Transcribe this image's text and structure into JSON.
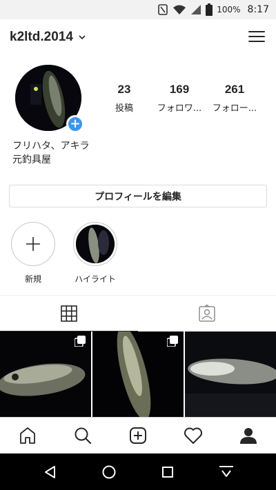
{
  "status_bar": {
    "battery": "100%",
    "time": "8:17"
  },
  "header": {
    "username": "k2ltd.2014"
  },
  "profile": {
    "stats": [
      {
        "value": "23",
        "label": "投稿"
      },
      {
        "value": "169",
        "label": "フォロワ..."
      },
      {
        "value": "261",
        "label": "フォロー..."
      }
    ],
    "bio_lines": [
      "フリハタ、アキラ",
      "元釣具屋"
    ],
    "edit_button": "プロフィールを編集"
  },
  "highlights": [
    {
      "label": "新規"
    },
    {
      "label": "ハイライト"
    }
  ],
  "tabs": [
    {
      "icon": "grid-icon",
      "active": true
    },
    {
      "icon": "tagged-icon",
      "active": false
    }
  ],
  "bottom_nav": [
    "home-icon",
    "search-icon",
    "add-post-icon",
    "activity-icon",
    "profile-icon"
  ],
  "colors": {
    "accent": "#3897f0",
    "text": "#262626",
    "border": "#dbdbdb"
  }
}
